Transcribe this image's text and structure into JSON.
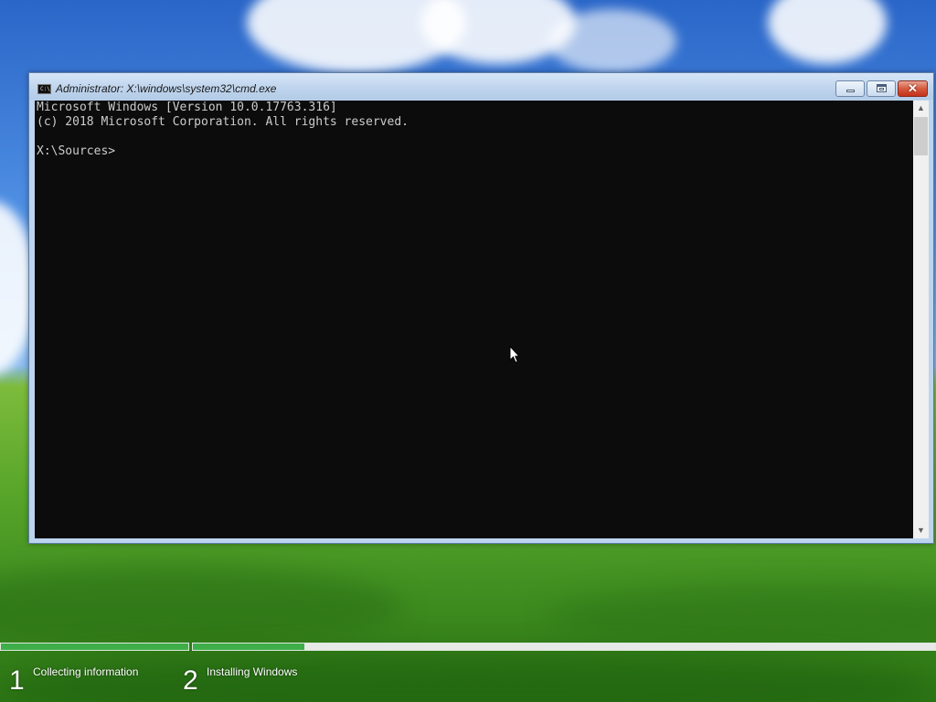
{
  "window": {
    "title": "Administrator: X:\\windows\\system32\\cmd.exe",
    "icon": "cmd-icon",
    "icon_text": "C:\\",
    "controls": {
      "minimize": "minimize-icon",
      "maximize": "maximize-icon",
      "close": "close-icon",
      "close_glyph": "✕"
    }
  },
  "console": {
    "lines": [
      "Microsoft Windows [Version 10.0.17763.316]",
      "(c) 2018 Microsoft Corporation. All rights reserved.",
      "",
      "X:\\Sources>"
    ],
    "scroll_up_glyph": "▲",
    "scroll_down_glyph": "▼"
  },
  "setup": {
    "steps": [
      {
        "number": "1",
        "label": "Collecting information",
        "progress": 1.0
      },
      {
        "number": "2",
        "label": "Installing Windows",
        "progress": 0.15
      }
    ],
    "accent_color": "#3fae49"
  }
}
